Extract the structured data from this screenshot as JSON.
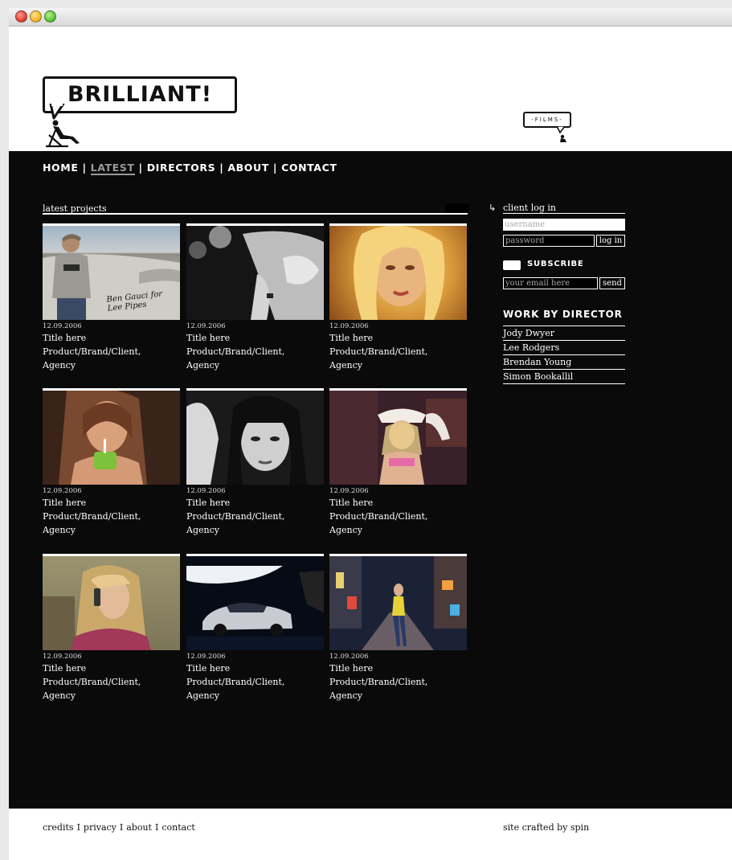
{
  "brand": {
    "logo_text": "BRILLIANT!",
    "films_text": "-FILMS-"
  },
  "nav": {
    "items": [
      "HOME",
      "LATEST",
      "DIRECTORS",
      "ABOUT",
      "CONTACT"
    ],
    "separator": "|",
    "active": "LATEST"
  },
  "latest": {
    "title": "latest projects",
    "projects": [
      {
        "date": "12.09.2006",
        "title": "Title here",
        "brand": "Product/Brand/Client, Agency",
        "overlay": "Ben Gauci for Lee Pipes"
      },
      {
        "date": "12.09.2006",
        "title": "Title here",
        "brand": "Product/Brand/Client, Agency"
      },
      {
        "date": "12.09.2006",
        "title": "Title here",
        "brand": "Product/Brand/Client, Agency"
      },
      {
        "date": "12.09.2006",
        "title": "Title here",
        "brand": "Product/Brand/Client, Agency"
      },
      {
        "date": "12.09.2006",
        "title": "Title here",
        "brand": "Product/Brand/Client, Agency"
      },
      {
        "date": "12.09.2006",
        "title": "Title here",
        "brand": "Product/Brand/Client, Agency"
      },
      {
        "date": "12.09.2006",
        "title": "Title here",
        "brand": "Product/Brand/Client, Agency"
      },
      {
        "date": "12.09.2006",
        "title": "Title here",
        "brand": "Product/Brand/Client, Agency"
      },
      {
        "date": "12.09.2006",
        "title": "Title here",
        "brand": "Product/Brand/Client, Agency"
      }
    ]
  },
  "sidebar": {
    "login": {
      "label": "client log in",
      "username_placeholder": "username",
      "password_placeholder": "password",
      "button": "log in"
    },
    "subscribe": {
      "label": "SUBSCRIBE",
      "email_placeholder": "your email here",
      "button": "send"
    },
    "directors": {
      "title": "WORK BY DIRECTOR",
      "items": [
        "Jody Dwyer",
        "Lee Rodgers",
        "Brendan Young",
        "Simon Bookallil"
      ]
    }
  },
  "footer": {
    "links": [
      "credits",
      "privacy",
      "about",
      "contact"
    ],
    "separator": "I",
    "credit": "site crafted by spin"
  },
  "colors": {
    "background": "#0a0a0a",
    "text": "#ffffff",
    "nav_active": "#9a9a9a"
  }
}
